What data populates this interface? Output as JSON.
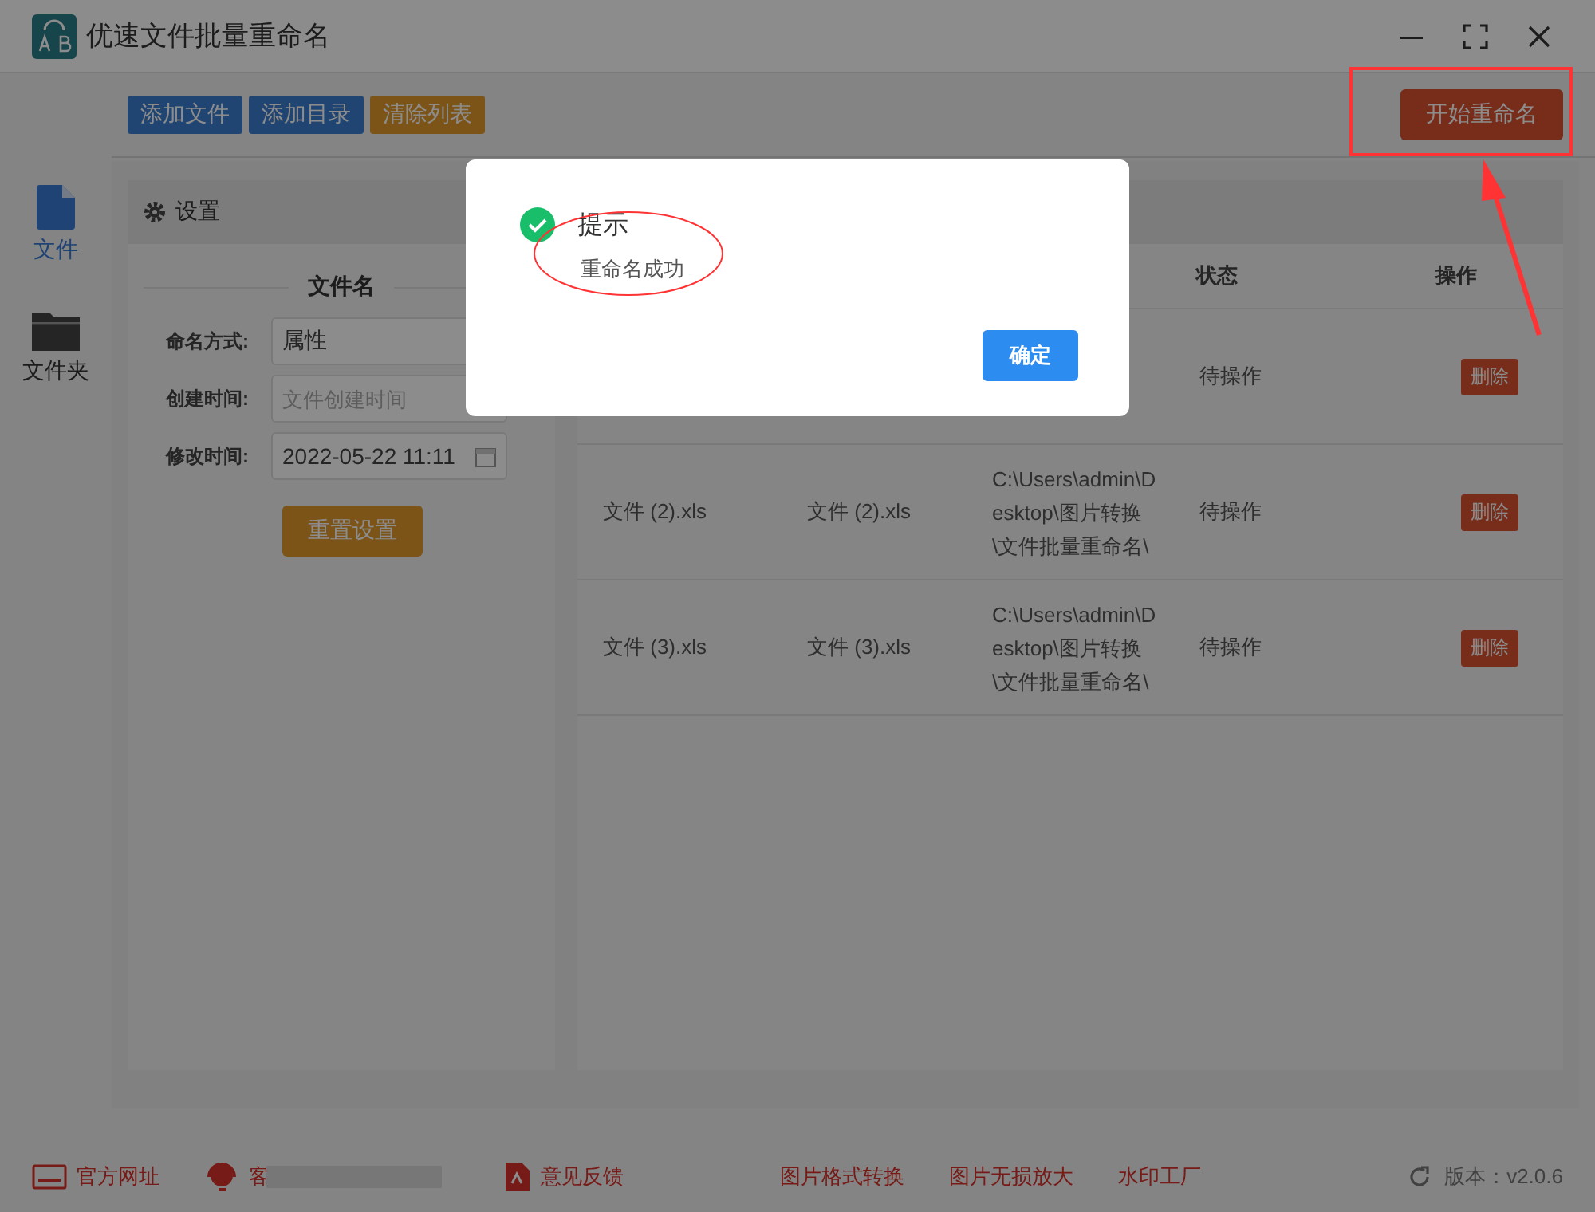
{
  "window": {
    "title": "优速文件批量重命名"
  },
  "sidebar": {
    "items": [
      {
        "label": "文件",
        "kind": "file",
        "selected": true
      },
      {
        "label": "文件夹",
        "kind": "folder",
        "selected": false
      }
    ]
  },
  "toolbar": {
    "buttons": [
      {
        "label": "添加文件",
        "kind": "primary"
      },
      {
        "label": "添加目录",
        "kind": "primary"
      },
      {
        "label": "清除列表",
        "kind": "warning"
      }
    ],
    "start_button": "开始重命名"
  },
  "settings": {
    "title": "设置",
    "section": "文件名",
    "fields": [
      {
        "label": "命名方式:",
        "value": "属性",
        "kind": "select"
      },
      {
        "label": "创建时间:",
        "placeholder": "文件创建时间",
        "kind": "text"
      },
      {
        "label": "修改时间:",
        "value": "2022-05-22 11:11",
        "kind": "date"
      }
    ],
    "reset_button": "重置设置"
  },
  "table": {
    "columns": [
      {
        "label": "状态"
      },
      {
        "label": "操作"
      }
    ],
    "rows": [
      {
        "status": "待操作",
        "action": "删除"
      },
      {
        "original": "文件 (2).xls",
        "new_name": "文件 (2).xls",
        "path": "C:\\Users\\admin\\Desktop\\图片转换\\文件批量重命名\\",
        "status": "待操作",
        "action": "删除"
      },
      {
        "original": "文件 (3).xls",
        "new_name": "文件 (3).xls",
        "path": "C:\\Users\\admin\\Desktop\\图片转换\\文件批量重命名\\",
        "status": "待操作",
        "action": "删除"
      }
    ]
  },
  "dialog": {
    "title": "提示",
    "message": "重命名成功",
    "button": "确定"
  },
  "footer": {
    "links": [
      {
        "label": "官方网址",
        "kind": "web"
      },
      {
        "label": "客",
        "kind": "support"
      },
      {
        "label": "意见反馈",
        "kind": "feedback"
      },
      {
        "label": "图片格式转换",
        "kind": "text"
      },
      {
        "label": "图片无损放大",
        "kind": "text"
      },
      {
        "label": "水印工厂",
        "kind": "text"
      }
    ],
    "version": "版本：v2.0.6"
  }
}
